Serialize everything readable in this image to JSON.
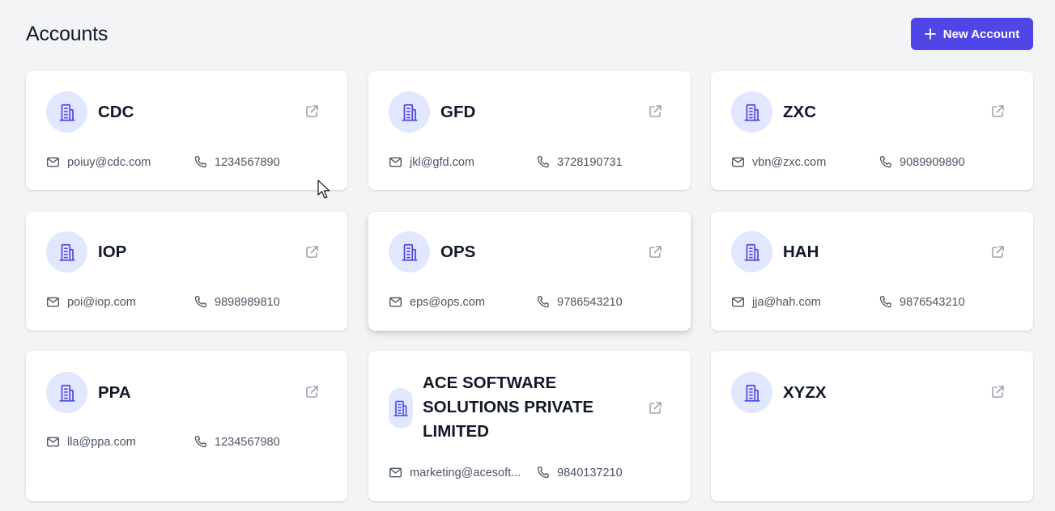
{
  "header": {
    "title": "Accounts",
    "new_account_label": "New Account"
  },
  "icons": {
    "account": "building-icon",
    "open": "external-link-icon",
    "email": "mail-icon",
    "phone": "phone-icon",
    "add": "plus-icon"
  },
  "colors": {
    "accent": "#4f46e5",
    "avatar_bg": "#e0e7ff",
    "page_bg": "#f3f4f6"
  },
  "accounts": [
    {
      "name": "CDC",
      "email": "poiuy@cdc.com",
      "phone": "1234567890"
    },
    {
      "name": "GFD",
      "email": "jkl@gfd.com",
      "phone": "3728190731"
    },
    {
      "name": "ZXC",
      "email": "vbn@zxc.com",
      "phone": "9089909890"
    },
    {
      "name": "IOP",
      "email": "poi@iop.com",
      "phone": "9898989810"
    },
    {
      "name": "OPS",
      "email": "eps@ops.com",
      "phone": "9786543210"
    },
    {
      "name": "HAH",
      "email": "jja@hah.com",
      "phone": "9876543210"
    },
    {
      "name": "PPA",
      "email": "lla@ppa.com",
      "phone": "1234567980"
    },
    {
      "name": "ACE SOFTWARE SOLUTIONS PRIVATE LIMITED",
      "email": "marketing@acesoft...",
      "phone": "9840137210"
    },
    {
      "name": "XYZX",
      "email": "",
      "phone": ""
    }
  ]
}
